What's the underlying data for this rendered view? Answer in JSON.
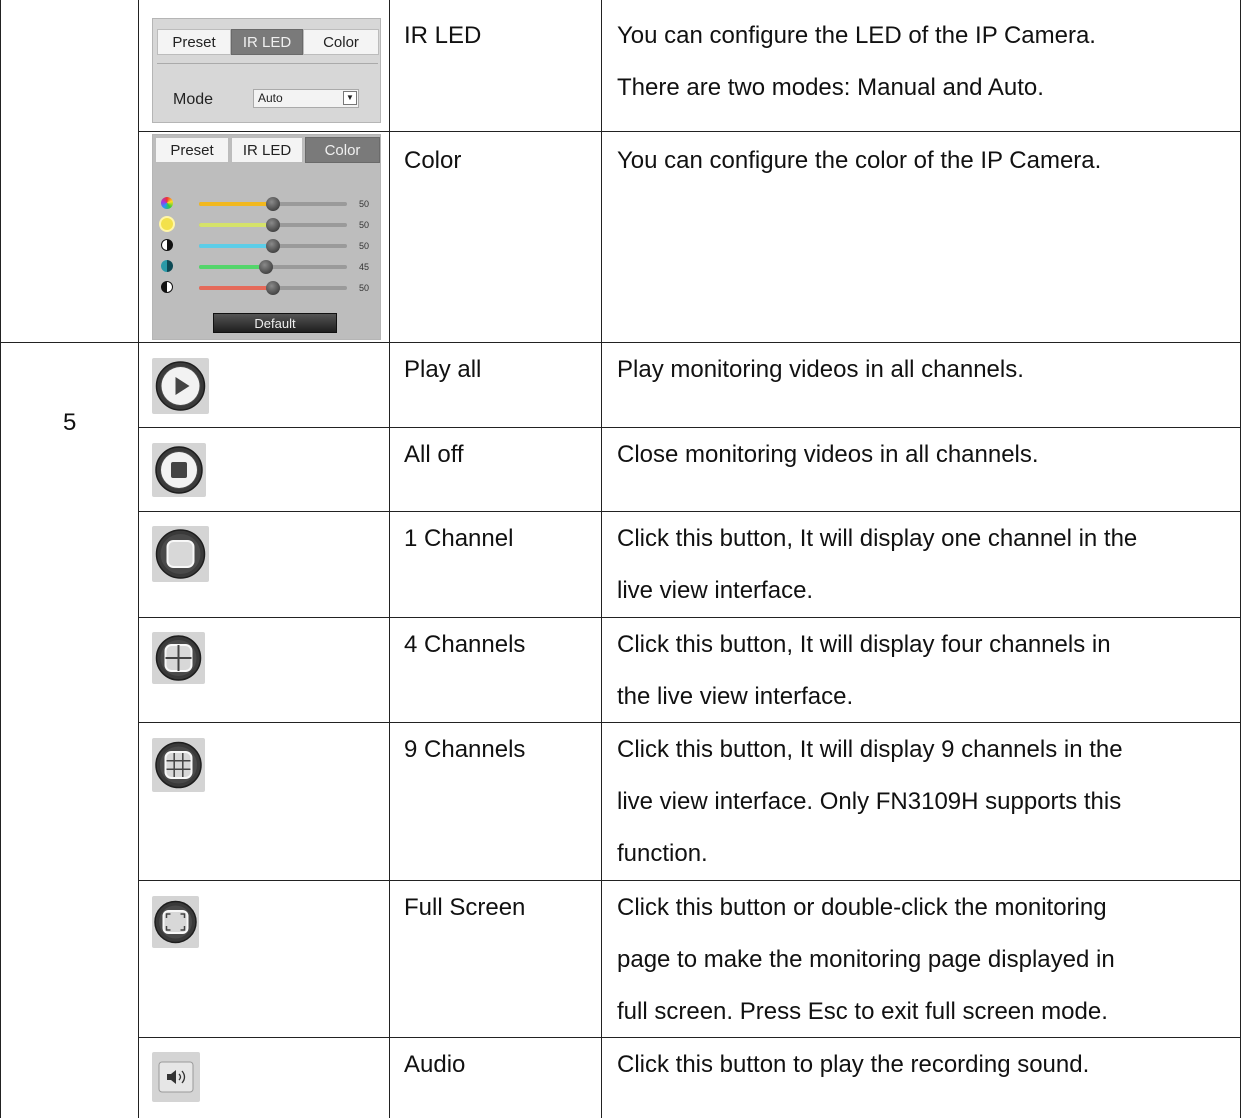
{
  "table": {
    "row_number": "5",
    "ir_led": {
      "name": "IR LED",
      "desc": [
        "You can configure the LED of the IP Camera.",
        "There are two modes: Manual and Auto."
      ],
      "tabs": [
        "Preset",
        "IR LED",
        "Color"
      ],
      "mode_label": "Mode",
      "mode_value": "Auto"
    },
    "color": {
      "name": "Color",
      "desc": [
        "You can configure the color of the IP Camera."
      ],
      "tabs": [
        "Preset",
        "IR LED",
        "Color"
      ],
      "sliders": [
        {
          "icon": "hue-icon",
          "color": "#f2b81f",
          "value": 50,
          "label": "50"
        },
        {
          "icon": "brightness-icon",
          "color": "#d5e26a",
          "value": 50,
          "label": "50"
        },
        {
          "icon": "contrast-icon",
          "color": "#5ccde8",
          "value": 50,
          "label": "50"
        },
        {
          "icon": "saturation-icon",
          "color": "#54d56b",
          "value": 45,
          "label": "45"
        },
        {
          "icon": "sharpness-icon",
          "color": "#e56a5a",
          "value": 50,
          "label": "50"
        }
      ],
      "default_label": "Default"
    },
    "rows": [
      {
        "icon": "play-icon",
        "name": "Play all",
        "desc": [
          "Play monitoring videos in all channels."
        ]
      },
      {
        "icon": "stop-icon",
        "name": "All off",
        "desc": [
          "Close monitoring videos in all channels."
        ]
      },
      {
        "icon": "one-channel-icon",
        "name": "1 Channel",
        "desc": [
          "Click this button, It will display one channel in the",
          "live view interface."
        ]
      },
      {
        "icon": "four-channels-icon",
        "name": "4 Channels",
        "desc": [
          "Click this button, It will display four channels in",
          "the live view interface."
        ]
      },
      {
        "icon": "nine-channels-icon",
        "name": "9 Channels",
        "desc": [
          "Click this button, It will display 9 channels in the",
          "live view interface. Only FN3109H supports this",
          "function."
        ]
      },
      {
        "icon": "fullscreen-icon",
        "name": "Full Screen",
        "desc": [
          "Click this button or double-click the monitoring",
          "page to make the monitoring page displayed in",
          "full screen. Press Esc to exit full screen mode."
        ]
      },
      {
        "icon": "audio-icon",
        "name": "Audio",
        "desc": [
          "Click this button to play the recording sound."
        ]
      }
    ]
  }
}
